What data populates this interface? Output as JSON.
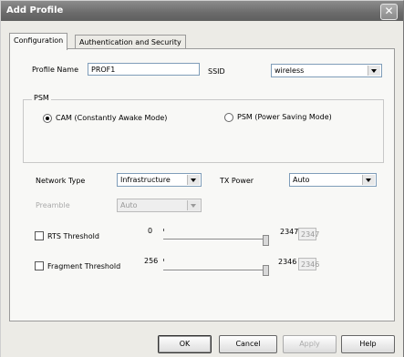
{
  "window": {
    "title": "Add Profile"
  },
  "tabs": [
    {
      "label": "Configuration"
    },
    {
      "label": "Authentication and Security"
    }
  ],
  "config": {
    "profile_name_label": "Profile Name",
    "profile_name_value": "PROF1",
    "ssid_label": "SSID",
    "ssid_value": "wireless",
    "psm_group_label": "PSM",
    "psm_options": [
      {
        "label": "CAM (Constantly Awake Mode)",
        "selected": true
      },
      {
        "label": "PSM (Power Saving Mode)",
        "selected": false
      }
    ],
    "network_type_label": "Network Type",
    "network_type_value": "Infrastructure",
    "tx_power_label": "TX Power",
    "tx_power_value": "Auto",
    "preamble_label": "Preamble",
    "preamble_value": "Auto",
    "rts": {
      "label": "RTS Threshold",
      "checked": false,
      "min": "0",
      "max": "2347",
      "value": "2347"
    },
    "fragment": {
      "label": "Fragment Threshold",
      "checked": false,
      "min": "256",
      "max": "2346",
      "value": "2346"
    }
  },
  "buttons": {
    "ok": "OK",
    "cancel": "Cancel",
    "apply": "Apply",
    "help": "Help"
  }
}
